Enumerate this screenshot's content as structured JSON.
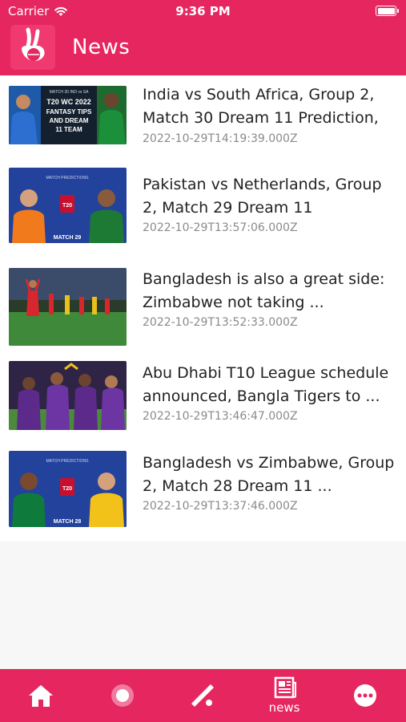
{
  "status_bar": {
    "carrier": "Carrier",
    "time": "9:36 PM"
  },
  "header": {
    "title": "News"
  },
  "news": [
    {
      "title": "India vs South Africa, Group 2, Match 30 Dream 11 Prediction, ...",
      "date": "2022-10-29T14:19:39.000Z",
      "thumb_text": [
        "MATCH 30 IND vs SA",
        "T20 WC 2022",
        "FANTASY TIPS",
        "AND DREAM",
        "11 TEAM"
      ]
    },
    {
      "title": "Pakistan vs Netherlands, Group 2, Match 29 Dream 11 Prediction,...",
      "date": "2022-10-29T13:57:06.000Z",
      "thumb_text": [
        "MATCH PREDICTIONS",
        "MATCH 29"
      ]
    },
    {
      "title": "Bangladesh is also a great side: Zimbabwe not taking ...",
      "date": "2022-10-29T13:52:33.000Z"
    },
    {
      "title": "Abu Dhabi T10 League schedule announced, Bangla Tigers to ...",
      "date": "2022-10-29T13:46:47.000Z"
    },
    {
      "title": "Bangladesh vs Zimbabwe, Group 2, Match 28 Dream 11 ...",
      "date": "2022-10-29T13:37:46.000Z",
      "thumb_text": [
        "MATCH PREDICTIONS",
        "MATCH 28"
      ]
    }
  ],
  "tabs": [
    {
      "icon": "home-icon",
      "label": ""
    },
    {
      "icon": "record-icon",
      "label": ""
    },
    {
      "icon": "cricket-bat-icon",
      "label": ""
    },
    {
      "icon": "newspaper-icon",
      "label": "news"
    },
    {
      "icon": "more-icon",
      "label": ""
    }
  ],
  "colors": {
    "accent": "#e6275f",
    "title_text": "#222222",
    "date_text": "#8a8a8a"
  }
}
